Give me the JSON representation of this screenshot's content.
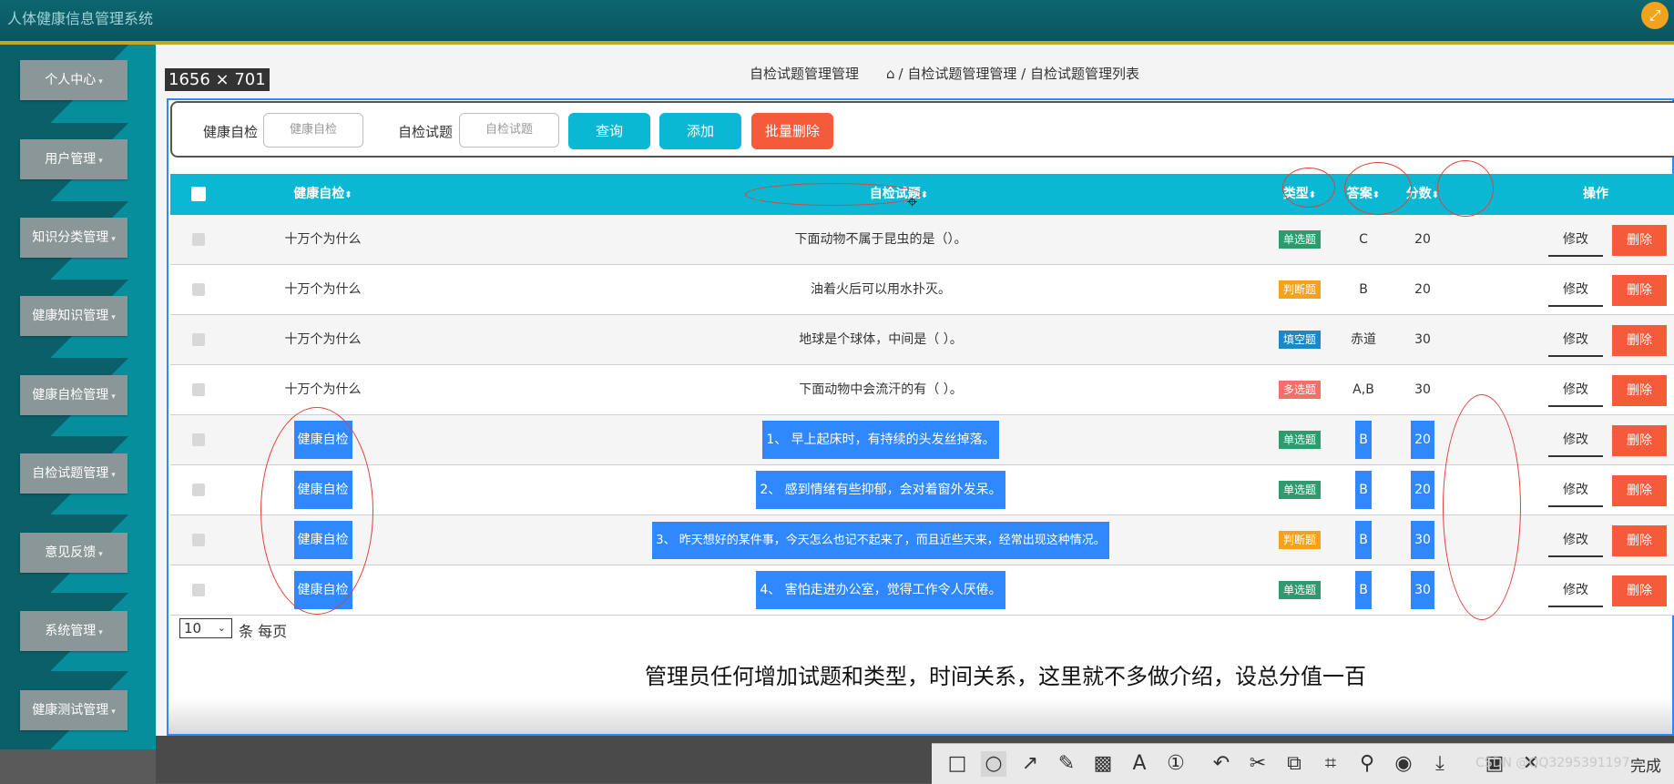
{
  "app": {
    "title": "人体健康信息管理系统",
    "corner_icon": "expand-icon"
  },
  "sidebar": {
    "items": [
      {
        "label": "个人中心"
      },
      {
        "label": "用户管理"
      },
      {
        "label": "知识分类管理"
      },
      {
        "label": "健康知识管理"
      },
      {
        "label": "健康自检管理"
      },
      {
        "label": "自检试题管理"
      },
      {
        "label": "意见反馈"
      },
      {
        "label": "系统管理"
      },
      {
        "label": "健康测试管理"
      }
    ]
  },
  "overlay": {
    "dimensions": "1656 × 701"
  },
  "header": {
    "page_title": "自检试题管理管理",
    "breadcrumb": "/ 自检试题管理管理 / 自检试题管理列表"
  },
  "search": {
    "field1_label": "健康自检",
    "field1_placeholder": "健康自检",
    "field2_label": "自检试题",
    "field2_placeholder": "自检试题",
    "query_btn": "查询",
    "add_btn": "添加",
    "batch_delete_btn": "批量删除"
  },
  "table": {
    "columns": {
      "health_check": "健康自检",
      "question": "自检试题",
      "type": "类型",
      "answer": "答案",
      "score": "分数",
      "actions": "操作"
    },
    "edit_label": "修改",
    "delete_label": "删除",
    "rows": [
      {
        "health_check": "十万个为什么",
        "question": "下面动物不属于昆虫的是（）。",
        "type": "单选题",
        "answer": "C",
        "score": "20"
      },
      {
        "health_check": "十万个为什么",
        "question": "油着火后可以用水扑灭。",
        "type": "判断题",
        "answer": "B",
        "score": "20"
      },
      {
        "health_check": "十万个为什么",
        "question": "地球是个球体，中间是（ ）。",
        "type": "填空题",
        "answer": "赤道",
        "score": "30"
      },
      {
        "health_check": "十万个为什么",
        "question": "下面动物中会流汗的有（ ）。",
        "type": "多选题",
        "answer": "A,B",
        "score": "30"
      },
      {
        "health_check": "健康自检",
        "question": "1、 早上起床时，有持续的头发丝掉落。",
        "type": "单选题",
        "answer": "B",
        "score": "20"
      },
      {
        "health_check": "健康自检",
        "question": "2、 感到情绪有些抑郁，会对着窗外发呆。",
        "type": "单选题",
        "answer": "B",
        "score": "20"
      },
      {
        "health_check": "健康自检",
        "question": "3、 昨天想好的某件事，今天怎么也记不起来了，而且近些天来，经常出现这种情况。",
        "type": "判断题",
        "answer": "B",
        "score": "30"
      },
      {
        "health_check": "健康自检",
        "question": "4、 害怕走进办公室，觉得工作令人厌倦。",
        "type": "单选题",
        "answer": "B",
        "score": "30"
      }
    ]
  },
  "pager": {
    "page_size": "10",
    "suffix": "条 每页"
  },
  "caption": "管理员任何增加试题和类型，时间关系，这里就不多做介绍，设总分值一百",
  "toolbar": {
    "done_label": "完成"
  },
  "watermark": "CSDN @QQ3295391197",
  "colors": {
    "type_single": "#2e9a6d",
    "type_judge": "#f2a31d",
    "type_fill": "#1e88c7",
    "type_multi": "#f2706a",
    "header": "#0ab8d3",
    "primary": "#0ab8d3",
    "danger": "#f55a3a",
    "highlight": "#2f88ff"
  }
}
